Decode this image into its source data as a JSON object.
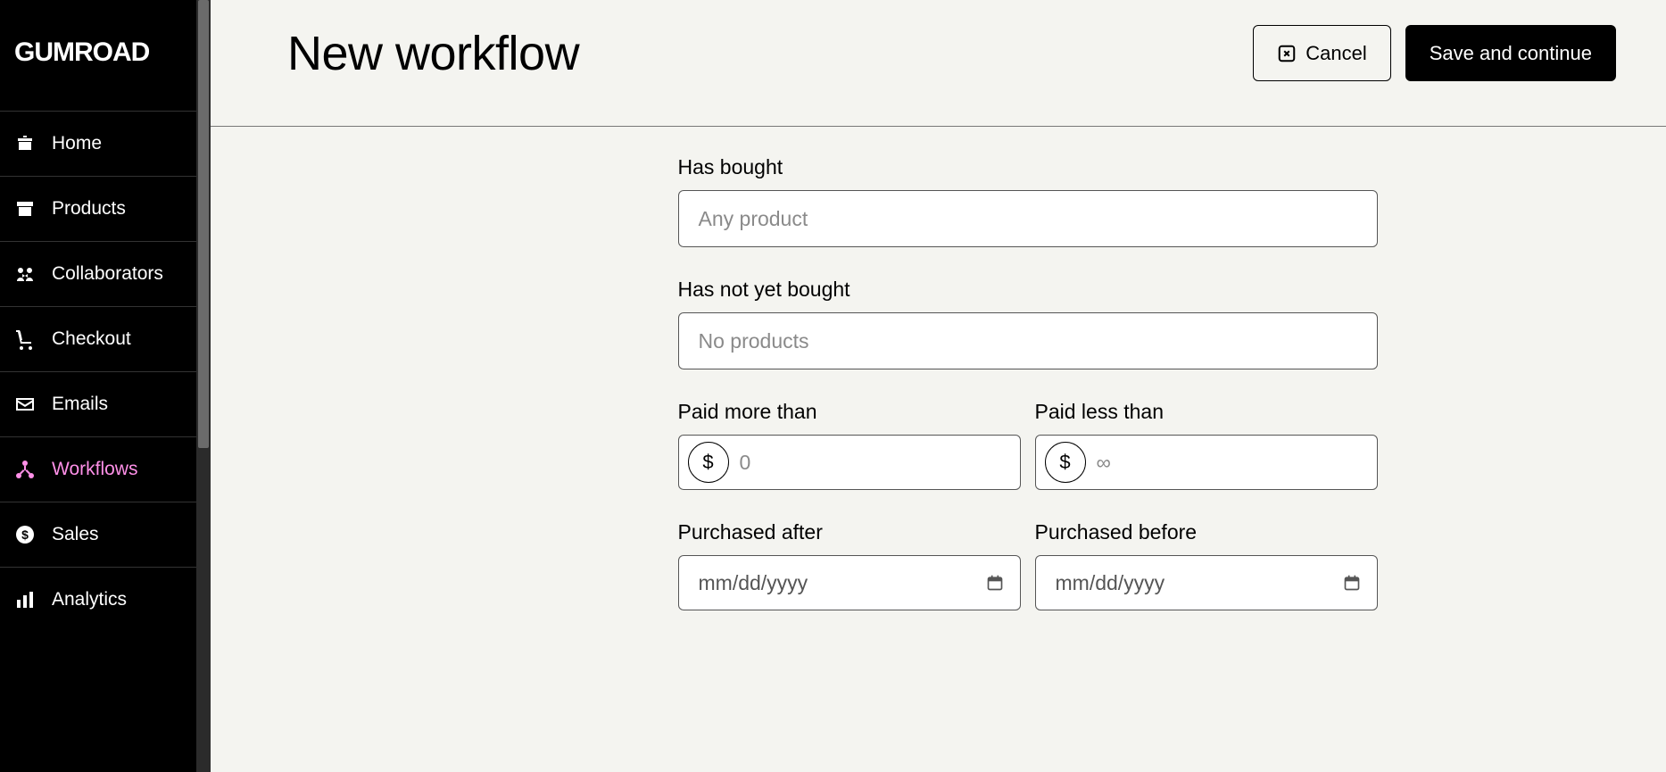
{
  "brand": "Gumroad",
  "sidebar": {
    "items": [
      {
        "label": "Home",
        "icon": "home-icon"
      },
      {
        "label": "Products",
        "icon": "archive-icon"
      },
      {
        "label": "Collaborators",
        "icon": "people-arrows-icon"
      },
      {
        "label": "Checkout",
        "icon": "cart-icon"
      },
      {
        "label": "Emails",
        "icon": "envelope-icon"
      },
      {
        "label": "Workflows",
        "icon": "diagram-icon",
        "active": true
      },
      {
        "label": "Sales",
        "icon": "dollar-circle-icon"
      },
      {
        "label": "Analytics",
        "icon": "bar-chart-icon"
      }
    ]
  },
  "header": {
    "title": "New workflow",
    "cancel_label": "Cancel",
    "save_label": "Save and continue"
  },
  "form": {
    "has_bought": {
      "label": "Has bought",
      "placeholder": "Any product",
      "value": ""
    },
    "has_not_bought": {
      "label": "Has not yet bought",
      "placeholder": "No products",
      "value": ""
    },
    "paid_more": {
      "label": "Paid more than",
      "currency": "$",
      "placeholder": "0",
      "value": ""
    },
    "paid_less": {
      "label": "Paid less than",
      "currency": "$",
      "placeholder": "∞",
      "value": ""
    },
    "purchased_after": {
      "label": "Purchased after",
      "placeholder": "mm/dd/yyyy",
      "value": ""
    },
    "purchased_before": {
      "label": "Purchased before",
      "placeholder": "mm/dd/yyyy",
      "value": ""
    }
  }
}
